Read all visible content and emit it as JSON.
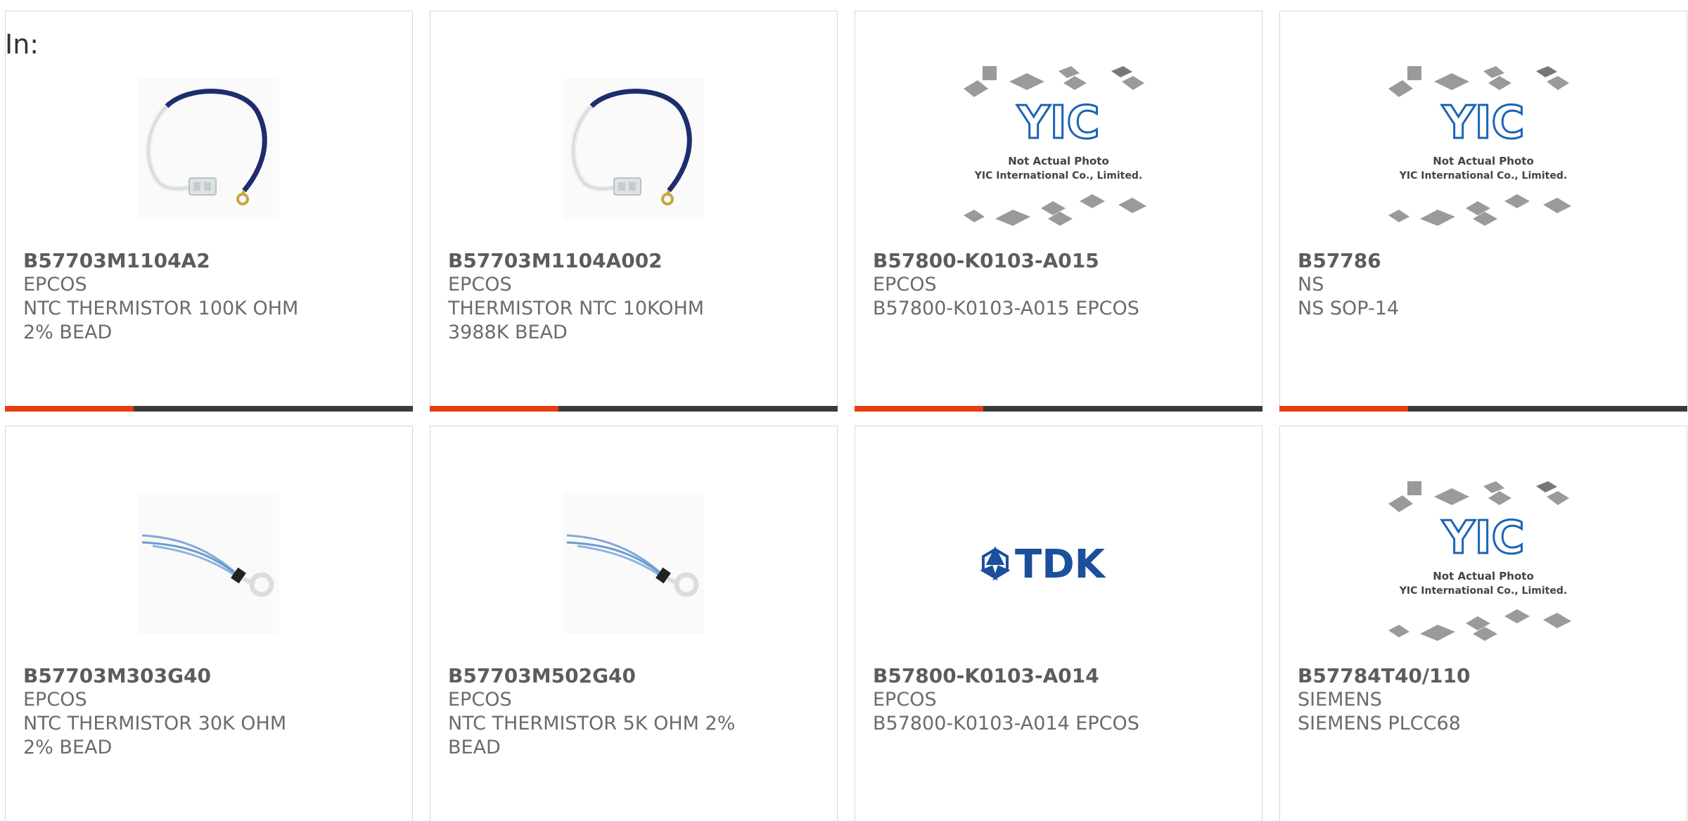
{
  "header": {
    "in_label": "In:"
  },
  "colors": {
    "accent": "#e63d11",
    "bar": "#3b3b3b",
    "text": "#6b6b6b",
    "border": "#d6d6d6"
  },
  "products": [
    {
      "part_number": "B57703M1104A2",
      "manufacturer": "EPCOS",
      "description": "NTC THERMISTOR 100K OHM 2% BEAD",
      "image": "cable-thermistor-image"
    },
    {
      "part_number": "B57703M1104A002",
      "manufacturer": "EPCOS",
      "description": "THERMISTOR NTC 10KOHM 3988K BEAD",
      "image": "cable-thermistor-image"
    },
    {
      "part_number": "B57800-K0103-A015",
      "manufacturer": "EPCOS",
      "description": "B57800-K0103-A015 EPCOS",
      "image": "yic-placeholder-image"
    },
    {
      "part_number": "B57786",
      "manufacturer": "NS",
      "description": "NS SOP-14",
      "image": "yic-placeholder-image"
    },
    {
      "part_number": "B57703M303G40",
      "manufacturer": "EPCOS",
      "description": "NTC THERMISTOR 30K OHM 2% BEAD",
      "image": "ring-thermistor-image"
    },
    {
      "part_number": "B57703M502G40",
      "manufacturer": "EPCOS",
      "description": "NTC THERMISTOR 5K OHM 2% BEAD",
      "image": "ring-thermistor-image"
    },
    {
      "part_number": "B57800-K0103-A014",
      "manufacturer": "EPCOS",
      "description": "B57800-K0103-A014 EPCOS",
      "image": "tdk-logo-image"
    },
    {
      "part_number": "B57784T40/110",
      "manufacturer": "SIEMENS",
      "description": "SIEMENS PLCC68",
      "image": "yic-placeholder-image"
    }
  ],
  "yic_placeholder": {
    "logo_text": "YIC",
    "line1": "Not Actual Photo",
    "line2": "YIC International Co., Limited."
  },
  "tdk_logo": {
    "text": "TDK"
  }
}
